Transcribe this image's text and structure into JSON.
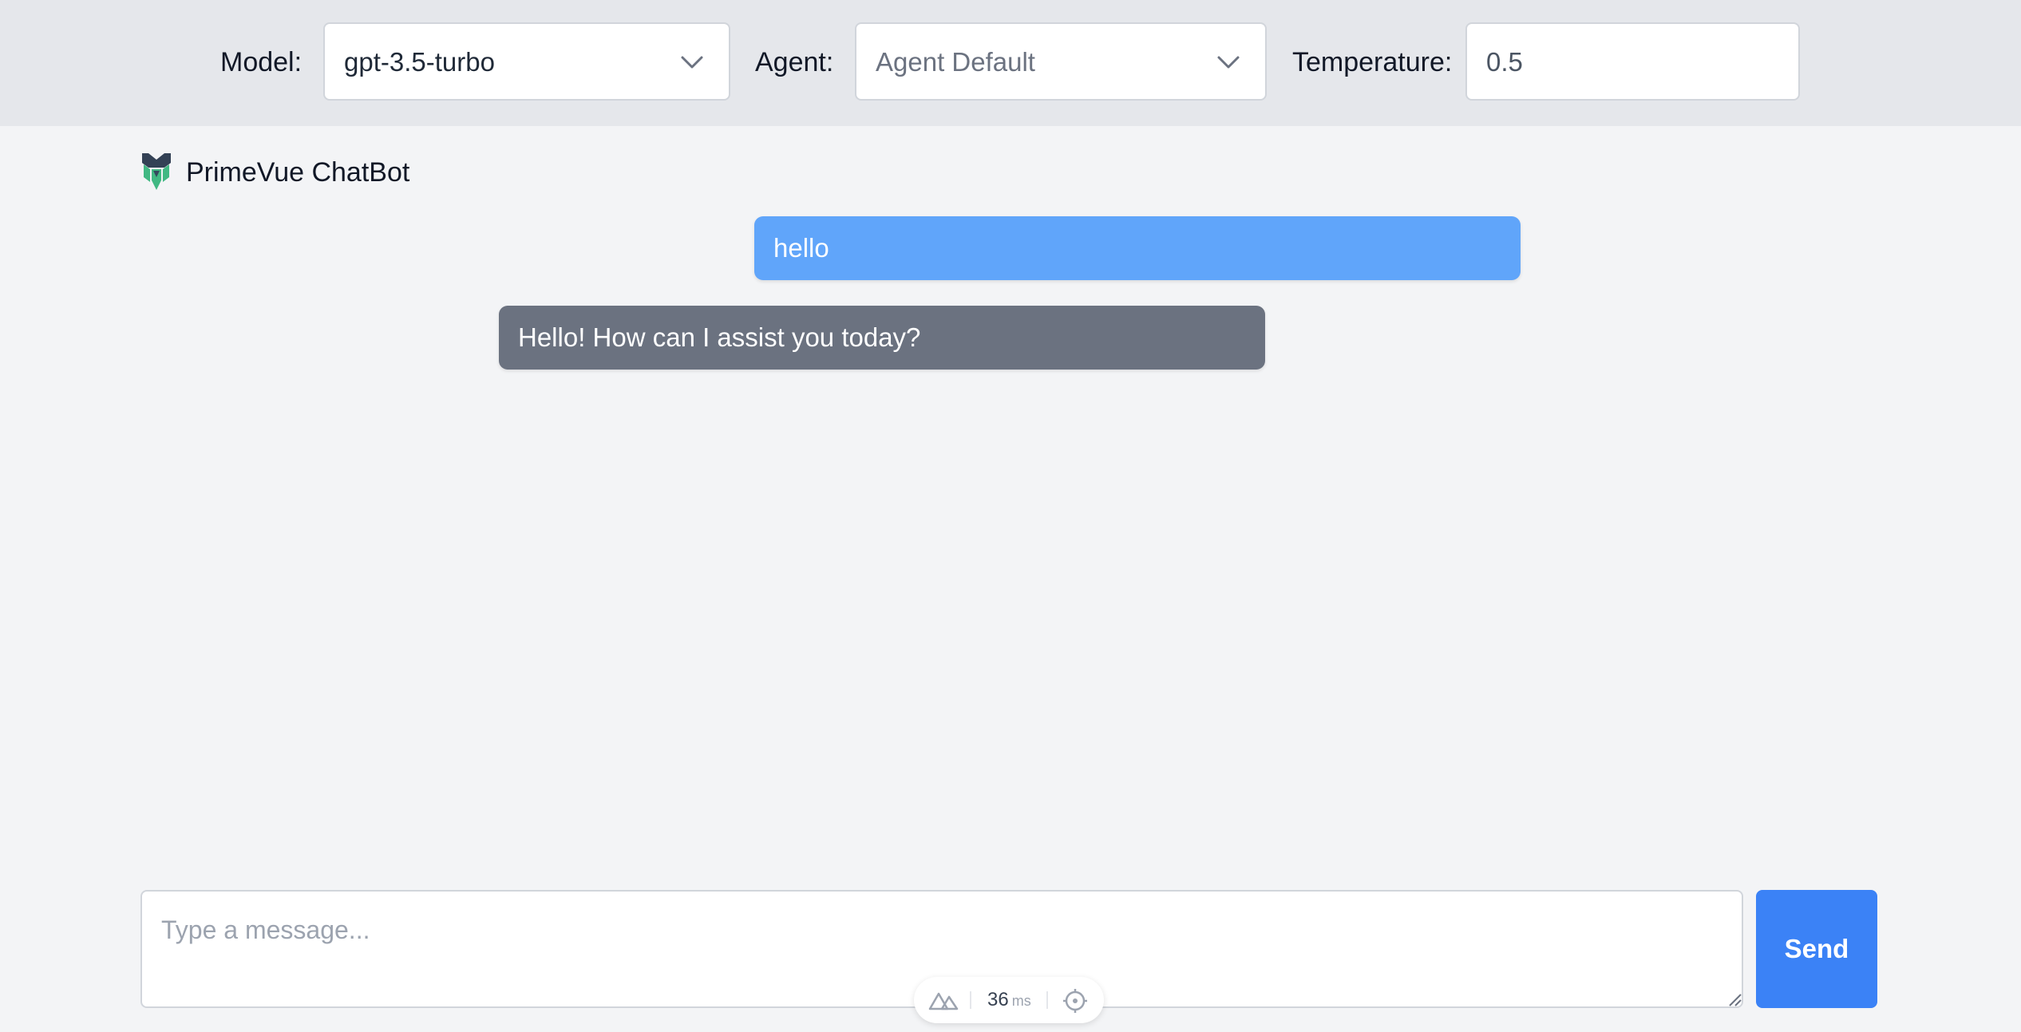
{
  "header": {
    "model_label": "Model:",
    "model_value": "gpt-3.5-turbo",
    "agent_label": "Agent:",
    "agent_value": "Agent Default",
    "temperature_label": "Temperature:",
    "temperature_value": "0.5"
  },
  "brand": {
    "name": "PrimeVue ChatBot",
    "logo_icon": "primevue-logo-icon"
  },
  "messages": [
    {
      "role": "user",
      "text": "hello"
    },
    {
      "role": "assistant",
      "text": "Hello! How can I assist you today?"
    }
  ],
  "composer": {
    "placeholder": "Type a message...",
    "send_label": "Send"
  },
  "devtools": {
    "render_time": "36",
    "unit": "ms"
  },
  "colors": {
    "user_bubble": "#60a5fa",
    "assistant_bubble": "#6b7280",
    "send_button": "#3b82f6",
    "header_bg": "#e5e7eb",
    "page_bg": "#f3f4f6"
  }
}
